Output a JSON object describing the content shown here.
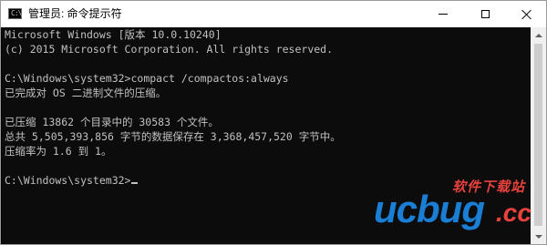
{
  "window": {
    "title": "管理员: 命令提示符",
    "app_icon_glyph": "C:\\"
  },
  "console": {
    "lines": [
      "Microsoft Windows [版本 10.0.10240]",
      "(c) 2015 Microsoft Corporation. All rights reserved.",
      "",
      "C:\\Windows\\system32>compact /compactos:always",
      "已完成对 OS 二进制文件的压缩。",
      "",
      "已压缩 13862 个目录中的 30583 个文件。",
      "总共 5,505,393,856 字节的数据保存在 3,368,457,520 字节中。",
      "压缩率为 1.6 到 1。",
      "",
      "C:\\Windows\\system32>"
    ]
  },
  "watermark": {
    "tagline": "软件下载站",
    "brand": "ucbug",
    "tld": ".cc"
  },
  "colors": {
    "console_bg": "#0c0c0c",
    "console_fg": "#c0c0c0",
    "watermark_blue": "#1a7fd4",
    "watermark_red": "#e8423c"
  },
  "icons": {
    "app": "console-app-icon",
    "minimize": "minimize-icon",
    "maximize": "maximize-icon",
    "close": "close-icon"
  }
}
